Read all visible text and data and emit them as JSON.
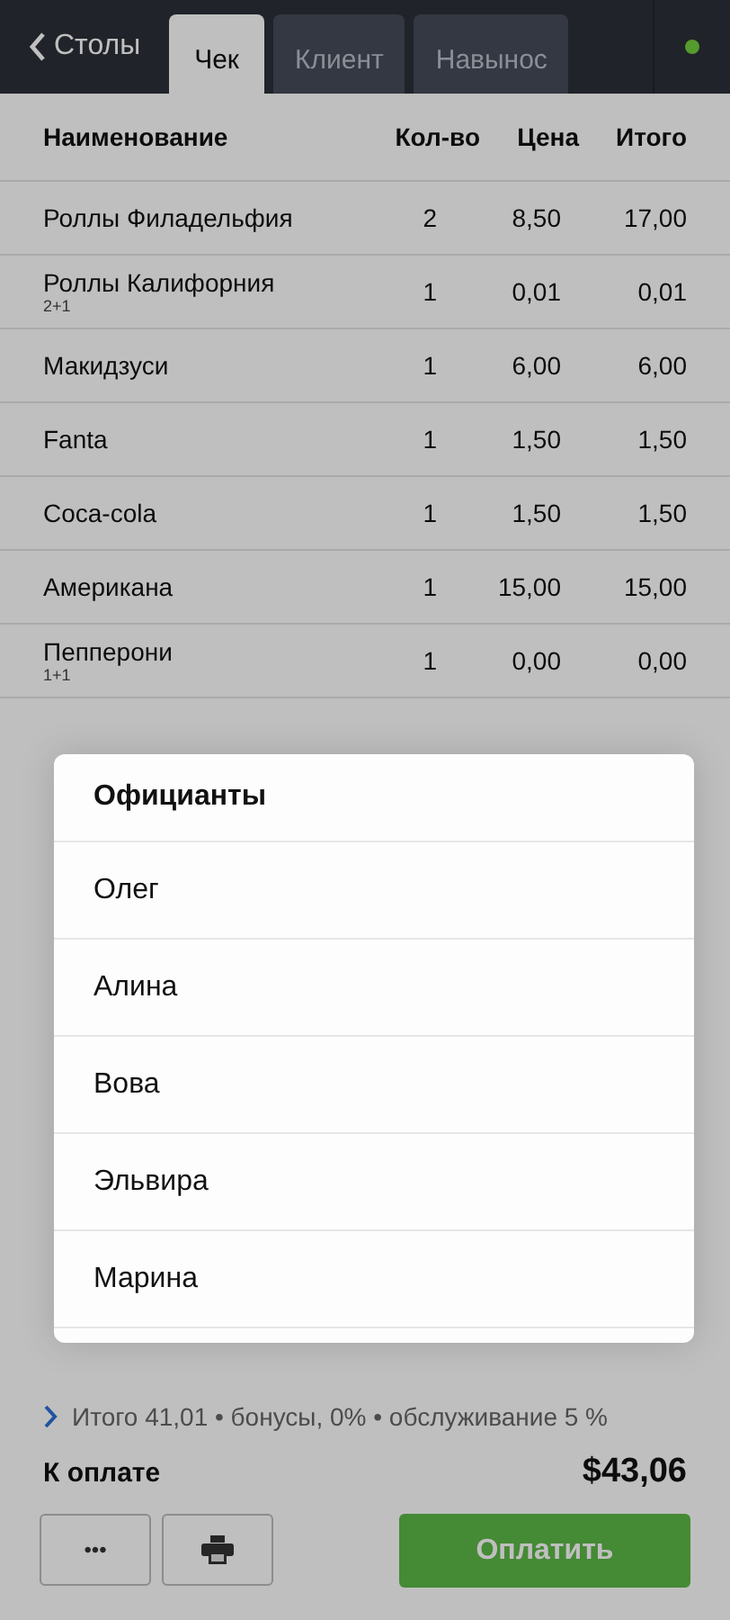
{
  "header": {
    "back": "Столы",
    "tabs": [
      {
        "label": "Чек",
        "selected": true
      },
      {
        "label": "Клиент",
        "selected": false
      },
      {
        "label": "Навынос",
        "selected": false
      }
    ]
  },
  "table": {
    "columns": [
      "Наименование",
      "Кол-во",
      "Цена",
      "Итого"
    ],
    "rows": [
      {
        "name": "Роллы Филадельфия",
        "qty": "2",
        "price": "8,50",
        "total": "17,00"
      },
      {
        "name": "Роллы Калифорния",
        "note": "2+1",
        "qty": "1",
        "price": "0,01",
        "total": "0,01"
      },
      {
        "name": "Макидзуси",
        "qty": "1",
        "price": "6,00",
        "total": "6,00"
      },
      {
        "name": "Fanta",
        "qty": "1",
        "price": "1,50",
        "total": "1,50"
      },
      {
        "name": "Coca-cola",
        "qty": "1",
        "price": "1,50",
        "total": "1,50"
      },
      {
        "name": "Американа",
        "qty": "1",
        "price": "15,00",
        "total": "15,00"
      },
      {
        "name": "Пепперони",
        "note": "1+1",
        "qty": "1",
        "price": "0,00",
        "total": "0,00"
      }
    ]
  },
  "summary": {
    "details": "Итого 41,01 • бонусы, 0% • обслуживание 5 %",
    "due_label": "К оплате",
    "due": "$43,06"
  },
  "actions": {
    "more": "•••",
    "pay": "Оплатить"
  },
  "popup": {
    "title": "Официанты",
    "items": [
      "Олег",
      "Алина",
      "Вова",
      "Эльвира",
      "Марина"
    ]
  }
}
